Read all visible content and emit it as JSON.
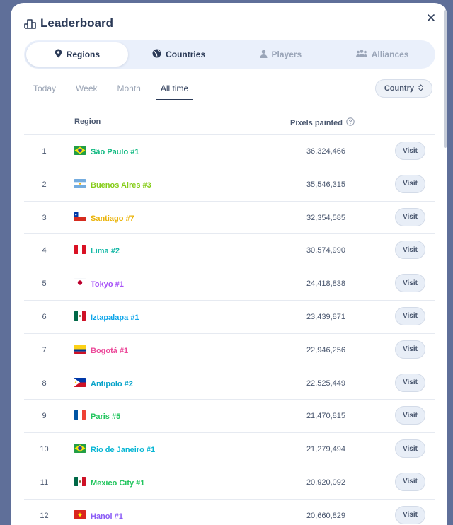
{
  "header": {
    "title": "Leaderboard",
    "icon": "chart-icon"
  },
  "tabs": [
    {
      "label": "Regions",
      "icon": "location-pin-icon",
      "state": "active"
    },
    {
      "label": "Countries",
      "icon": "globe-icon",
      "state": "semi"
    },
    {
      "label": "Players",
      "icon": "person-icon",
      "state": "inactive"
    },
    {
      "label": "Alliances",
      "icon": "group-icon",
      "state": "inactive"
    }
  ],
  "periods": [
    {
      "label": "Today",
      "active": false
    },
    {
      "label": "Week",
      "active": false
    },
    {
      "label": "Month",
      "active": false
    },
    {
      "label": "All time",
      "active": true
    }
  ],
  "filter": {
    "label": "Country"
  },
  "table": {
    "columns": {
      "region": "Region",
      "pixels": "Pixels painted"
    },
    "visit_label": "Visit",
    "rows": [
      {
        "rank": "1",
        "flag": "brazil-flag-icon",
        "name": "São Paulo #1",
        "color": "#10b981",
        "pixels": "36,324,466"
      },
      {
        "rank": "2",
        "flag": "argentina-flag-icon",
        "name": "Buenos Aires #3",
        "color": "#84cc16",
        "pixels": "35,546,315"
      },
      {
        "rank": "3",
        "flag": "chile-flag-icon",
        "name": "Santiago #7",
        "color": "#eab308",
        "pixels": "32,354,585"
      },
      {
        "rank": "4",
        "flag": "peru-flag-icon",
        "name": "Lima #2",
        "color": "#14b8a6",
        "pixels": "30,574,990"
      },
      {
        "rank": "5",
        "flag": "japan-flag-icon",
        "name": "Tokyo #1",
        "color": "#a855f7",
        "pixels": "24,418,838"
      },
      {
        "rank": "6",
        "flag": "mexico-flag-icon",
        "name": "Iztapalapa #1",
        "color": "#0ea5e9",
        "pixels": "23,439,871"
      },
      {
        "rank": "7",
        "flag": "colombia-flag-icon",
        "name": "Bogotá #1",
        "color": "#ec4899",
        "pixels": "22,946,256"
      },
      {
        "rank": "8",
        "flag": "philippines-flag-icon",
        "name": "Antipolo #2",
        "color": "#06a3c9",
        "pixels": "22,525,449"
      },
      {
        "rank": "9",
        "flag": "france-flag-icon",
        "name": "Paris #5",
        "color": "#22c55e",
        "pixels": "21,470,815"
      },
      {
        "rank": "10",
        "flag": "brazil-flag-icon",
        "name": "Rio de Janeiro #1",
        "color": "#06b6d4",
        "pixels": "21,279,494"
      },
      {
        "rank": "11",
        "flag": "mexico-flag-icon",
        "name": "Mexico City #1",
        "color": "#22c55e",
        "pixels": "20,920,092"
      },
      {
        "rank": "12",
        "flag": "vietnam-flag-icon",
        "name": "Hanoi #1",
        "color": "#8b5cf6",
        "pixels": "20,660,829"
      }
    ]
  }
}
